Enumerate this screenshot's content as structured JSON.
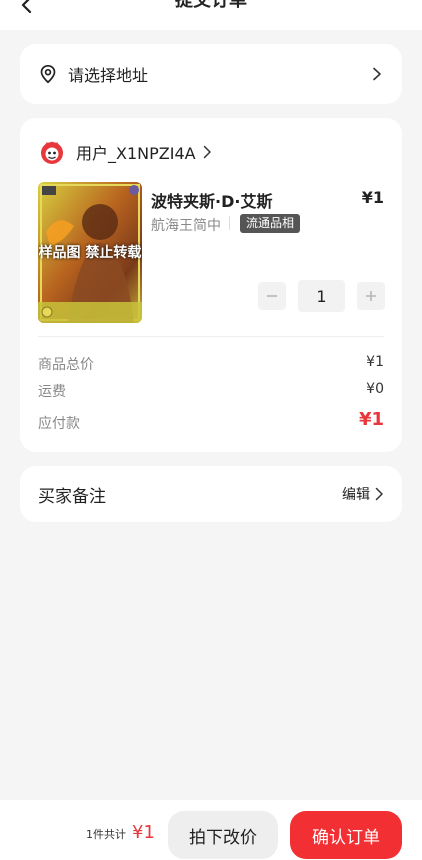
{
  "nav": {
    "title": "提交订单"
  },
  "address": {
    "placeholder_text": "请选择地址"
  },
  "seller": {
    "name": "用户_X1NPZI4A"
  },
  "product": {
    "name": "波特夹斯·D·艾斯",
    "price": "¥1",
    "series": "航海王简中",
    "condition_badge": "流通品相",
    "watermark": "样品图 禁止转载",
    "quantity": "1"
  },
  "summary": {
    "goods_total_label": "商品总价",
    "goods_total_value": "¥1",
    "shipping_label": "运费",
    "shipping_value": "¥0",
    "payable_label": "应付款",
    "payable_value": "¥1"
  },
  "note": {
    "label": "买家备注",
    "edit_label": "编辑"
  },
  "footer": {
    "count_text": "1件共计",
    "total": "¥1",
    "change_price_label": "拍下改价",
    "confirm_label": "确认订单"
  },
  "colors": {
    "accent": "#f22f33",
    "price_red": "#e8373b"
  },
  "icons": [
    "back-icon",
    "location-pin-icon",
    "chevron-right-icon",
    "seller-logo-icon",
    "minus-icon",
    "plus-icon"
  ]
}
